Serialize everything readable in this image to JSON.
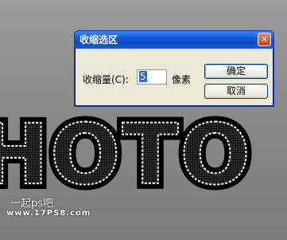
{
  "canvas_text": "HOTO",
  "dialog": {
    "title": "收缩选区",
    "close_icon": "close-icon",
    "contract_label": "收缩量(C):",
    "contract_value": "5",
    "unit": "像素",
    "ok_label": "确定",
    "cancel_label": "取消"
  },
  "watermark": {
    "line1": "一起ps吧",
    "line2": "www.17PS8.com"
  },
  "colors": {
    "titlebar": "#0b4bc4",
    "dialog_bg": "#ece9d8",
    "selection": "#316ac5"
  }
}
